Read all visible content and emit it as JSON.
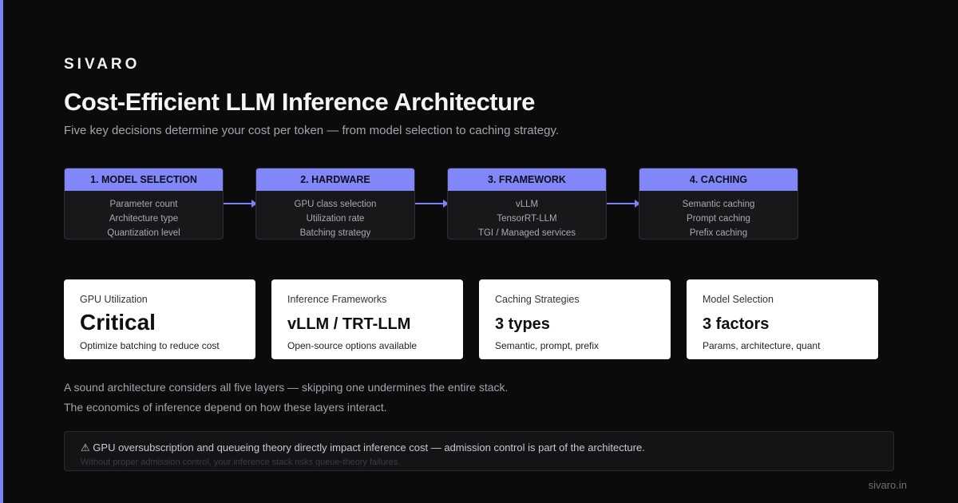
{
  "brand": "SIVARO",
  "title": "Cost-Efficient LLM Inference Architecture",
  "subtitle": "Five key decisions determine your cost per token — from model selection to caching strategy.",
  "colors": {
    "accent": "#7c83f7",
    "header": "#8187f8",
    "background": "#0b0b0c",
    "card": "#ffffff"
  },
  "steps": [
    {
      "title": "1. MODEL SELECTION",
      "items": [
        "Parameter count",
        "Architecture type",
        "Quantization level"
      ]
    },
    {
      "title": "2. HARDWARE",
      "items": [
        "GPU class selection",
        "Utilization rate",
        "Batching strategy"
      ]
    },
    {
      "title": "3. FRAMEWORK",
      "items": [
        "vLLM",
        "TensorRT-LLM",
        "TGI / Managed services"
      ]
    },
    {
      "title": "4. CACHING",
      "items": [
        "Semantic caching",
        "Prompt caching",
        "Prefix caching"
      ]
    }
  ],
  "metrics": [
    {
      "label": "GPU Utilization",
      "value": "Critical",
      "desc": "Optimize batching to reduce cost"
    },
    {
      "label": "Inference Frameworks",
      "value": "vLLM / TRT-LLM",
      "desc": "Open-source options available"
    },
    {
      "label": "Caching Strategies",
      "value": "3 types",
      "desc": "Semantic, prompt, prefix"
    },
    {
      "label": "Model Selection",
      "value": "3 factors",
      "desc": "Params, architecture, quant"
    }
  ],
  "notes": [
    "A sound architecture considers all five layers — skipping one undermines the entire stack.",
    "The economics of inference depend on how these layers interact."
  ],
  "callout": {
    "icon": "⚠",
    "main": "GPU oversubscription and queueing theory directly impact inference cost — admission control is part of the architecture.",
    "sub": "Without proper admission control, your inference stack risks queue-theory failures."
  },
  "footer": "sivaro.in"
}
